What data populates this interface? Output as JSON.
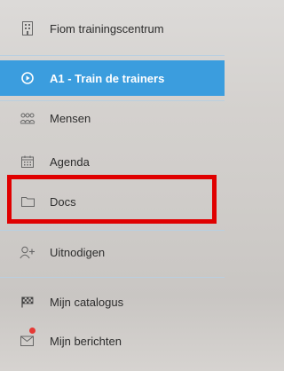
{
  "menu": {
    "items": [
      {
        "label": "Fiom trainingscentrum",
        "icon": "building-icon"
      },
      {
        "label": "A1 - Train de trainers",
        "icon": "play-circle-icon",
        "active": true
      },
      {
        "label": "Mensen",
        "icon": "people-group-icon"
      },
      {
        "label": "Agenda",
        "icon": "calendar-icon"
      },
      {
        "label": "Docs",
        "icon": "folder-icon",
        "highlighted": true
      },
      {
        "label": "Uitnodigen",
        "icon": "user-plus-icon"
      },
      {
        "label": "Mijn catalogus",
        "icon": "checkered-flag-icon"
      },
      {
        "label": "Mijn berichten",
        "icon": "envelope-icon",
        "notification": true
      }
    ]
  },
  "colors": {
    "active_bg": "#3b9dde",
    "highlight_border": "#e00000",
    "notification_dot": "#e53935",
    "divider": "#b9cfe0"
  }
}
